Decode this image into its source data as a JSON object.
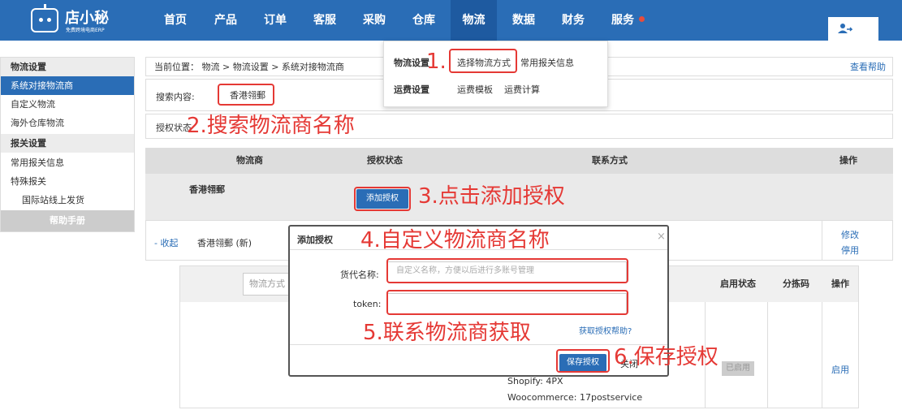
{
  "brand": {
    "name": "店小秘",
    "tagline": "免费跨境电商ERP"
  },
  "nav": [
    {
      "label": "首页"
    },
    {
      "label": "产品"
    },
    {
      "label": "订单"
    },
    {
      "label": "客服"
    },
    {
      "label": "采购"
    },
    {
      "label": "仓库"
    },
    {
      "label": "物流"
    },
    {
      "label": "数据"
    },
    {
      "label": "财务"
    },
    {
      "label": "服务"
    }
  ],
  "sidebar": {
    "items": [
      {
        "label": "物流设置"
      },
      {
        "label": "系统对接物流商"
      },
      {
        "label": "自定义物流"
      },
      {
        "label": "海外仓库物流"
      },
      {
        "label": "报关设置"
      },
      {
        "label": "常用报关信息"
      },
      {
        "label": "特殊报关"
      },
      {
        "label": "国际站线上发货"
      }
    ],
    "help": "帮助手册"
  },
  "breadcrumb": {
    "text": "当前位置： 物流 > 物流设置 > 系统对接物流商",
    "help_link": "查看帮助"
  },
  "search": {
    "label": "搜索内容:",
    "value": "香港翎郵"
  },
  "auth_filter": {
    "label": "授权状态"
  },
  "table": {
    "headers": {
      "carrier": "物流商",
      "auth": "授权状态",
      "contact": "联系方式",
      "ops": "操作"
    },
    "row": {
      "carrier": "香港翎郵",
      "add_button": "添加授权"
    }
  },
  "collapse_row": {
    "toggle": "- 收起",
    "name": "香港翎郵 (新)",
    "edit": "修改",
    "disable": "停用"
  },
  "inner_table": {
    "method_placeholder": "物流方式",
    "headers": {
      "enable_status": "启用状态",
      "sort_code": "分拣码",
      "ops": "操作"
    },
    "platform_lines": [
      "Shopify:   4PX",
      "Woocommerce:   17postservice"
    ],
    "enable_link": "启用",
    "gray_button": "已启用"
  },
  "dropdown": {
    "section1": "物流设置",
    "choose_method": "选择物流方式",
    "customs_info": "常用报关信息",
    "section2": "运费设置",
    "freight_template": "运费模板",
    "freight_calc": "运费计算"
  },
  "modal": {
    "title": "添加授权",
    "close": "×",
    "name_label": "货代名称:",
    "name_placeholder": "自定义名称，方便以后进行多账号管理",
    "token_label": "token:",
    "token_help": "获取授权帮助?",
    "save_button": "保存授权",
    "close_button": "关闭"
  },
  "annotations": {
    "a1": "1.",
    "a2": "2.搜索物流商名称",
    "a3": "3.点击添加授权",
    "a4": "4.自定义物流商名称",
    "a5": "5.联系物流商获取",
    "a6": "6.保存授权"
  },
  "colors": {
    "primary": "#2a6db6",
    "highlight": "#e53935",
    "badge": "#e74c3c"
  }
}
